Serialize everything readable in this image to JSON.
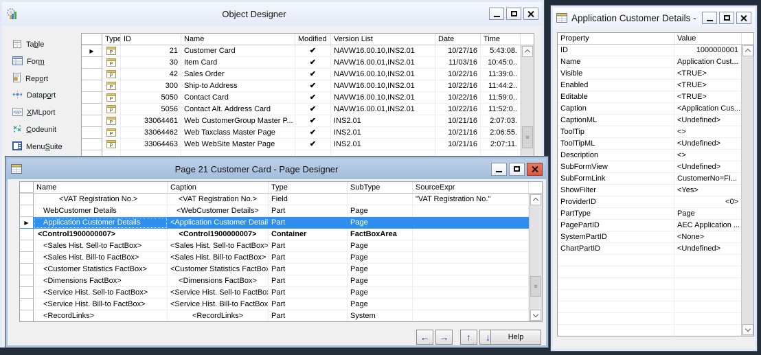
{
  "object_designer": {
    "title": "Object Designer",
    "sidebar_items": [
      {
        "pre": "Ta",
        "key": "b",
        "post": "le",
        "icon": "table-icon"
      },
      {
        "pre": "For",
        "key": "m",
        "post": "",
        "icon": "form-icon"
      },
      {
        "pre": "Rep",
        "key": "o",
        "post": "rt",
        "icon": "report-icon"
      },
      {
        "pre": "Datap",
        "key": "o",
        "post": "rt",
        "icon": "dataport-icon"
      },
      {
        "pre": "",
        "key": "X",
        "post": "MLport",
        "icon": "xmlport-icon"
      },
      {
        "pre": "",
        "key": "C",
        "post": "odeunit",
        "icon": "codeunit-icon"
      },
      {
        "pre": "Menu",
        "key": "S",
        "post": "uite",
        "icon": "menusuite-icon"
      }
    ],
    "columns": [
      "Type",
      "ID",
      "Name",
      "Modified",
      "Version List",
      "Date",
      "Time"
    ],
    "rows": [
      {
        "id": "21",
        "name": "Customer Card",
        "modified": true,
        "version_list": "NAVW16.00.10,INS2.01",
        "date": "10/27/16",
        "time": "5:43:08.",
        "selected": true
      },
      {
        "id": "30",
        "name": "Item Card",
        "modified": true,
        "version_list": "NAVW16.00.01,INS2.01",
        "date": "11/03/16",
        "time": "10:45:0.."
      },
      {
        "id": "42",
        "name": "Sales Order",
        "modified": true,
        "version_list": "NAVW16.00.10,INS2.01",
        "date": "10/22/16",
        "time": "11:39:0.."
      },
      {
        "id": "300",
        "name": "Ship-to Address",
        "modified": true,
        "version_list": "NAVW16.00.10,INS2.01",
        "date": "10/22/16",
        "time": "11:44:2.."
      },
      {
        "id": "5050",
        "name": "Contact Card",
        "modified": true,
        "version_list": "NAVW16.00.10,INS2.01",
        "date": "10/22/16",
        "time": "11:59:0.."
      },
      {
        "id": "5056",
        "name": "Contact Alt. Address Card",
        "modified": true,
        "version_list": "NAVW16.00.01,INS2.01",
        "date": "10/22/16",
        "time": "11:52:0.."
      },
      {
        "id": "33064461",
        "name": "Web CustomerGroup Master P...",
        "modified": true,
        "version_list": "INS2.01",
        "date": "10/21/16",
        "time": "2:07:03."
      },
      {
        "id": "33064462",
        "name": "Web Taxclass Master Page",
        "modified": true,
        "version_list": "INS2.01",
        "date": "10/21/16",
        "time": "2:06:55."
      },
      {
        "id": "33064463",
        "name": "Web WebSite Master Page",
        "modified": true,
        "version_list": "INS2.01",
        "date": "10/21/16",
        "time": "2:07:11."
      }
    ]
  },
  "page_designer": {
    "title": "Page 21 Customer Card - Page Designer",
    "columns": [
      "Name",
      "Caption",
      "Type",
      "SubType",
      "SourceExpr"
    ],
    "rows": [
      {
        "name": "<VAT Registration No.>",
        "caption": "<VAT Registration No.>",
        "type": "Field",
        "subtype": "",
        "source_expr": "\"VAT Registration No.\"",
        "level": 2
      },
      {
        "name": "WebCustomer Details",
        "caption": "<WebCustomer Details>",
        "type": "Part",
        "subtype": "Page",
        "source_expr": "",
        "level": 1
      },
      {
        "name": "Application Customer Details",
        "caption": "<Application Customer Details>",
        "type": "Part",
        "subtype": "Page",
        "source_expr": "",
        "level": 1,
        "selected": true
      },
      {
        "name": "<Control1900000007>",
        "caption": "<Control1900000007>",
        "type": "Container",
        "subtype": "FactBoxArea",
        "source_expr": "",
        "level": 0,
        "bold": true
      },
      {
        "name": "<Sales Hist. Sell-to FactBox>",
        "caption": "<Sales Hist. Sell-to FactBox>",
        "type": "Part",
        "subtype": "Page",
        "source_expr": "",
        "level": 1
      },
      {
        "name": "<Sales Hist. Bill-to FactBox>",
        "caption": "<Sales Hist. Bill-to FactBox>",
        "type": "Part",
        "subtype": "Page",
        "source_expr": "",
        "level": 1
      },
      {
        "name": "<Customer Statistics FactBox>",
        "caption": "<Customer Statistics FactBox>",
        "type": "Part",
        "subtype": "Page",
        "source_expr": "",
        "level": 1
      },
      {
        "name": "<Dimensions FactBox>",
        "caption": "<Dimensions FactBox>",
        "type": "Part",
        "subtype": "Page",
        "source_expr": "",
        "level": 1
      },
      {
        "name": "<Service Hist. Sell-to FactBox>",
        "caption": "<Service Hist. Sell-to FactBox>",
        "type": "Part",
        "subtype": "Page",
        "source_expr": "",
        "level": 1
      },
      {
        "name": "<Service Hist. Bill-to FactBox>",
        "caption": "<Service Hist. Bill-to FactBox>",
        "type": "Part",
        "subtype": "Page",
        "source_expr": "",
        "level": 1
      },
      {
        "name": "<RecordLinks>",
        "caption": "<RecordLinks>",
        "type": "Part",
        "subtype": "System",
        "source_expr": "",
        "level": 1
      }
    ],
    "help_label": "Help"
  },
  "property_window": {
    "title": "Application Customer Details - ...",
    "columns": [
      "Property",
      "Value"
    ],
    "rows": [
      {
        "property": "ID",
        "value": "1000000001",
        "align": "right"
      },
      {
        "property": "Name",
        "value": "Application Cust..."
      },
      {
        "property": "Visible",
        "value": "<TRUE>"
      },
      {
        "property": "Enabled",
        "value": "<TRUE>"
      },
      {
        "property": "Editable",
        "value": "<TRUE>"
      },
      {
        "property": "Caption",
        "value": "<Application Cus..."
      },
      {
        "property": "CaptionML",
        "value": "<Undefined>"
      },
      {
        "property": "ToolTip",
        "value": "<>"
      },
      {
        "property": "ToolTipML",
        "value": "<Undefined>"
      },
      {
        "property": "Description",
        "value": "<>"
      },
      {
        "property": "SubFormView",
        "value": "<Undefined>"
      },
      {
        "property": "SubFormLink",
        "value": "CustomerNo=FI..."
      },
      {
        "property": "ShowFilter",
        "value": "<Yes>"
      },
      {
        "property": "ProviderID",
        "value": "<0>",
        "align": "right"
      },
      {
        "property": "PartType",
        "value": "Page"
      },
      {
        "property": "PagePartID",
        "value": "AEC Application ..."
      },
      {
        "property": "SystemPartID",
        "value": "<None>"
      },
      {
        "property": "ChartPartID",
        "value": "<Undefined>"
      }
    ],
    "empty_row_count": 7
  },
  "colors": {
    "selection": "#2F8FEF",
    "active_titlebar": "#a9c2de",
    "close_button": "#dd5940",
    "desktop_background": "#242d3a"
  }
}
